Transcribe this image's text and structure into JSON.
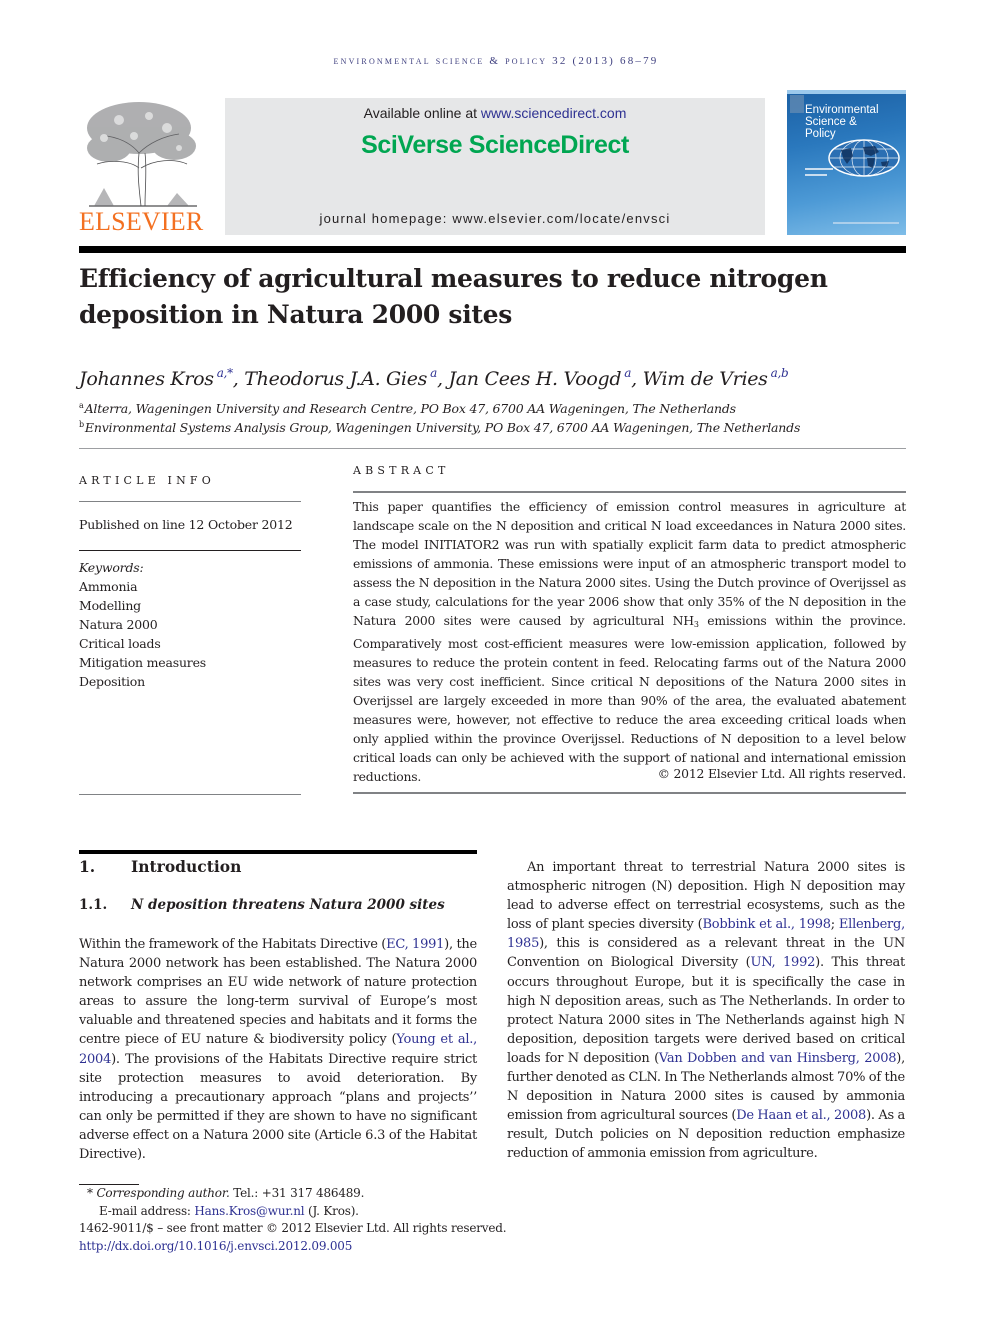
{
  "running_header": {
    "journal": "Environmental Science & Policy",
    "citation": "32 (2013) 68–79"
  },
  "publisher": {
    "logo_icon": "elsevier-tree-icon",
    "name": "ELSEVIER",
    "available_prefix": "Available online at ",
    "available_link": "www.sciencedirect.com",
    "brand": "SciVerse ScienceDirect",
    "homepage": "journal homepage: www.elsevier.com/locate/envsci"
  },
  "cover": {
    "title_line1": "Environmental",
    "title_line2": "Science &",
    "title_line3": "Policy",
    "globe_icon": "globe-icon"
  },
  "article": {
    "title": "Efficiency of agricultural measures to reduce nitrogen deposition in Natura 2000 sites",
    "authors": [
      {
        "name": "Johannes Kros",
        "sup": "a,*"
      },
      {
        "name": "Theodorus J.A. Gies",
        "sup": "a"
      },
      {
        "name": "Jan Cees H. Voogd",
        "sup": "a"
      },
      {
        "name": "Wim de Vries",
        "sup": "a,b"
      }
    ],
    "author_separator": ", ",
    "affiliations": [
      {
        "mark": "a",
        "text": "Alterra, Wageningen University and Research Centre, PO Box 47, 6700 AA Wageningen, The Netherlands"
      },
      {
        "mark": "b",
        "text": "Environmental Systems Analysis Group, Wageningen University, PO Box 47, 6700 AA Wageningen, The Netherlands"
      }
    ]
  },
  "article_info": {
    "heading": "ARTICLE INFO",
    "published": "Published on line 12 October 2012",
    "keywords_label": "Keywords:",
    "keywords": [
      "Ammonia",
      "Modelling",
      "Natura 2000",
      "Critical loads",
      "Mitigation measures",
      "Deposition"
    ]
  },
  "abstract": {
    "heading": "ABSTRACT",
    "part1": "This paper quantifies the efficiency of emission control measures in agriculture at landscape scale on the N deposition and critical N load exceedances in Natura 2000 sites. The model INITIATOR2 was run with spatially explicit farm data to predict atmospheric emissions of ammonia. These emissions were input of an atmospheric transport model to assess the N deposition in the Natura 2000 sites. Using the Dutch province of Overijssel as a case study, calculations for the year 2006 show that only 35% of the N deposition in the Natura 2000 sites were caused by agricultural NH",
    "sub": "3",
    "part2": " emissions within the province. Comparatively most cost-efficient measures were low-emission application, followed by measures to reduce the protein content in feed. Relocating farms out of the Natura 2000 sites was very cost inefficient. Since critical N depositions of the Natura 2000 sites in Overijssel are largely exceeded in more than 90% of the area, the evaluated abatement measures were, however, not effective to reduce the area exceeding critical loads when only applied within the province Overijssel. Reductions of N deposition to a level below critical loads can only be achieved with the support of national and international emission reductions.",
    "copyright": "© 2012 Elsevier Ltd. All rights reserved."
  },
  "introduction": {
    "section_num": "1.",
    "section_title": "Introduction",
    "subsection_num": "1.1.",
    "subsection_title": "N deposition threatens Natura 2000 sites",
    "left": {
      "t1": "Within the framework of the Habitats Directive (",
      "c1": "EC, 1991",
      "t2": "), the Natura 2000 network has been established. The Natura 2000 network comprises an EU wide network of nature protection areas to assure the long-term survival of Europe’s most valuable and threatened species and habitats and it forms the centre piece of EU nature & biodiversity policy (",
      "c2": "Young et al., 2004",
      "t3": "). The provisions of the Habitats Directive require strict site protection measures to avoid deterioration. By introducing a precautionary approach “plans and projects’’ can only be permitted if they are shown to have no significant adverse effect on a Natura 2000 site (Article 6.3 of the Habitat Directive)."
    },
    "right": {
      "t1": "An important threat to terrestrial Natura 2000 sites is atmospheric nitrogen (N) deposition. High N deposition may lead to adverse effect on terrestrial ecosystems, such as the loss of plant species diversity (",
      "c1": "Bobbink et al., 1998",
      "t2": "; ",
      "c2": "Ellenberg, 1985",
      "t3": "), this is considered as a relevant threat in the UN Convention on Biological Diversity (",
      "c3": "UN, 1992",
      "t4": "). This threat occurs throughout Europe, but it is specifically the case in high N deposition areas, such as The Netherlands. In order to protect Natura 2000 sites in The Netherlands against high N deposition, deposition targets were derived based on critical loads for N deposition (",
      "c4": "Van Dobben and van Hinsberg, 2008",
      "t5": "), further denoted as CLN. In The Netherlands almost 70% of the N deposition in Natura 2000 sites is caused by ammonia emission from agricultural sources (",
      "c5": "De Haan et al., 2008",
      "t6": "). As a result, Dutch policies on N deposition reduction emphasize reduction of ammonia emission from agriculture."
    }
  },
  "footnotes": {
    "star": "*",
    "corresponding_label": "Corresponding author.",
    "tel": " Tel.: +31 317 486489.",
    "email_label": "E-mail address: ",
    "email": "Hans.Kros@wur.nl",
    "email_suffix": " (J. Kros).",
    "front_matter": "1462-9011/$ – see front matter © 2012 Elsevier Ltd. All rights reserved.",
    "doi": "http://dx.doi.org/10.1016/j.envsci.2012.09.005"
  },
  "colors": {
    "link": "#2e3192",
    "sciencedirect_green": "#00a651",
    "elsevier_orange": "#f37021",
    "header_box": "#e6e7e8"
  }
}
